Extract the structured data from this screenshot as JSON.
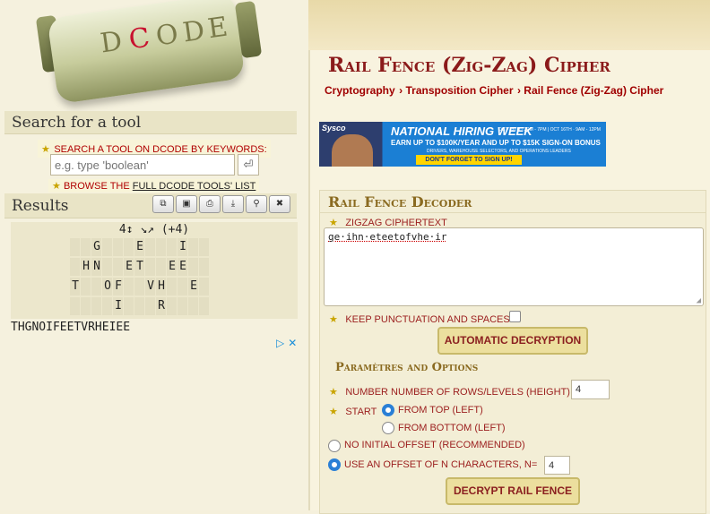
{
  "logo": {
    "letters": [
      "D",
      "C",
      "O",
      "D",
      "E"
    ],
    "accent": "#c8102e"
  },
  "search": {
    "heading": "Search for a tool",
    "keyword_label": "SEARCH A TOOL ON DCODE BY KEYWORDS:",
    "placeholder": "e.g. type 'boolean'",
    "browse_prefix": "BROWSE THE",
    "browse_link": "FULL DCODE TOOLS' LIST"
  },
  "results": {
    "heading": "Results",
    "toolbar_icons": [
      "copy-icon",
      "save-icon",
      "print-icon",
      "download-icon",
      "pin-icon",
      "close-icon"
    ],
    "grid_header": "4↕ ↘↗ (+4)",
    "rows": [
      [
        "",
        "",
        "G",
        "",
        "",
        "",
        "E",
        "",
        "",
        "",
        "I",
        "",
        ""
      ],
      [
        "",
        "H",
        "N",
        "",
        "",
        "E",
        "T",
        "",
        "",
        "E",
        "E",
        "",
        ""
      ],
      [
        "T",
        "",
        "",
        "O",
        "F",
        "",
        "",
        "V",
        "H",
        "",
        "",
        "E",
        ""
      ],
      [
        "",
        "",
        "",
        "",
        "I",
        "",
        "",
        "",
        "R",
        "",
        "",
        "",
        ""
      ]
    ],
    "output": "THGNOIFEETVRHEIEE"
  },
  "page": {
    "title": "Rail Fence (Zig-Zag) Cipher",
    "breadcrumb": [
      "Cryptography",
      "Transposition Cipher",
      "Rail Fence (Zig-Zag) Cipher"
    ]
  },
  "ad": {
    "brand": "Sysco",
    "headline": "NATIONAL HIRING WEEK",
    "dates": "OCT 13TH · 3PM - 7PM | OCT 16TH · 9AM - 12PM",
    "pay": "EARN UP TO $100K/YEAR AND UP TO $15K SIGN-ON BONUS",
    "roles": "DRIVERS, WAREHOUSE SELECTORS, AND OPERATIONS LEADERS",
    "cta": "DON'T FORGET TO SIGN UP!"
  },
  "decoder": {
    "heading": "Rail Fence Decoder",
    "ciphertext_label": "ZIGZAG CIPHERTEXT",
    "ciphertext": "ge·ihn·eteetofvhe·ir",
    "keep_punct_label": "KEEP PUNCTUATION AND SPACES",
    "auto_button": "AUTOMATIC DECRYPTION",
    "params_heading": "Paramètres and Options",
    "rows_label": "NUMBER NUMBER OF ROWS/LEVELS (HEIGHT)",
    "rows_value": "4",
    "start_label": "START",
    "from_top": "FROM TOP (LEFT)",
    "from_bottom": "FROM BOTTOM (LEFT)",
    "no_offset": "NO INITIAL OFFSET (RECOMMENDED)",
    "use_offset": "USE AN OFFSET OF N CHARACTERS, N=",
    "offset_value": "4",
    "decrypt_button": "DECRYPT RAIL FENCE"
  }
}
